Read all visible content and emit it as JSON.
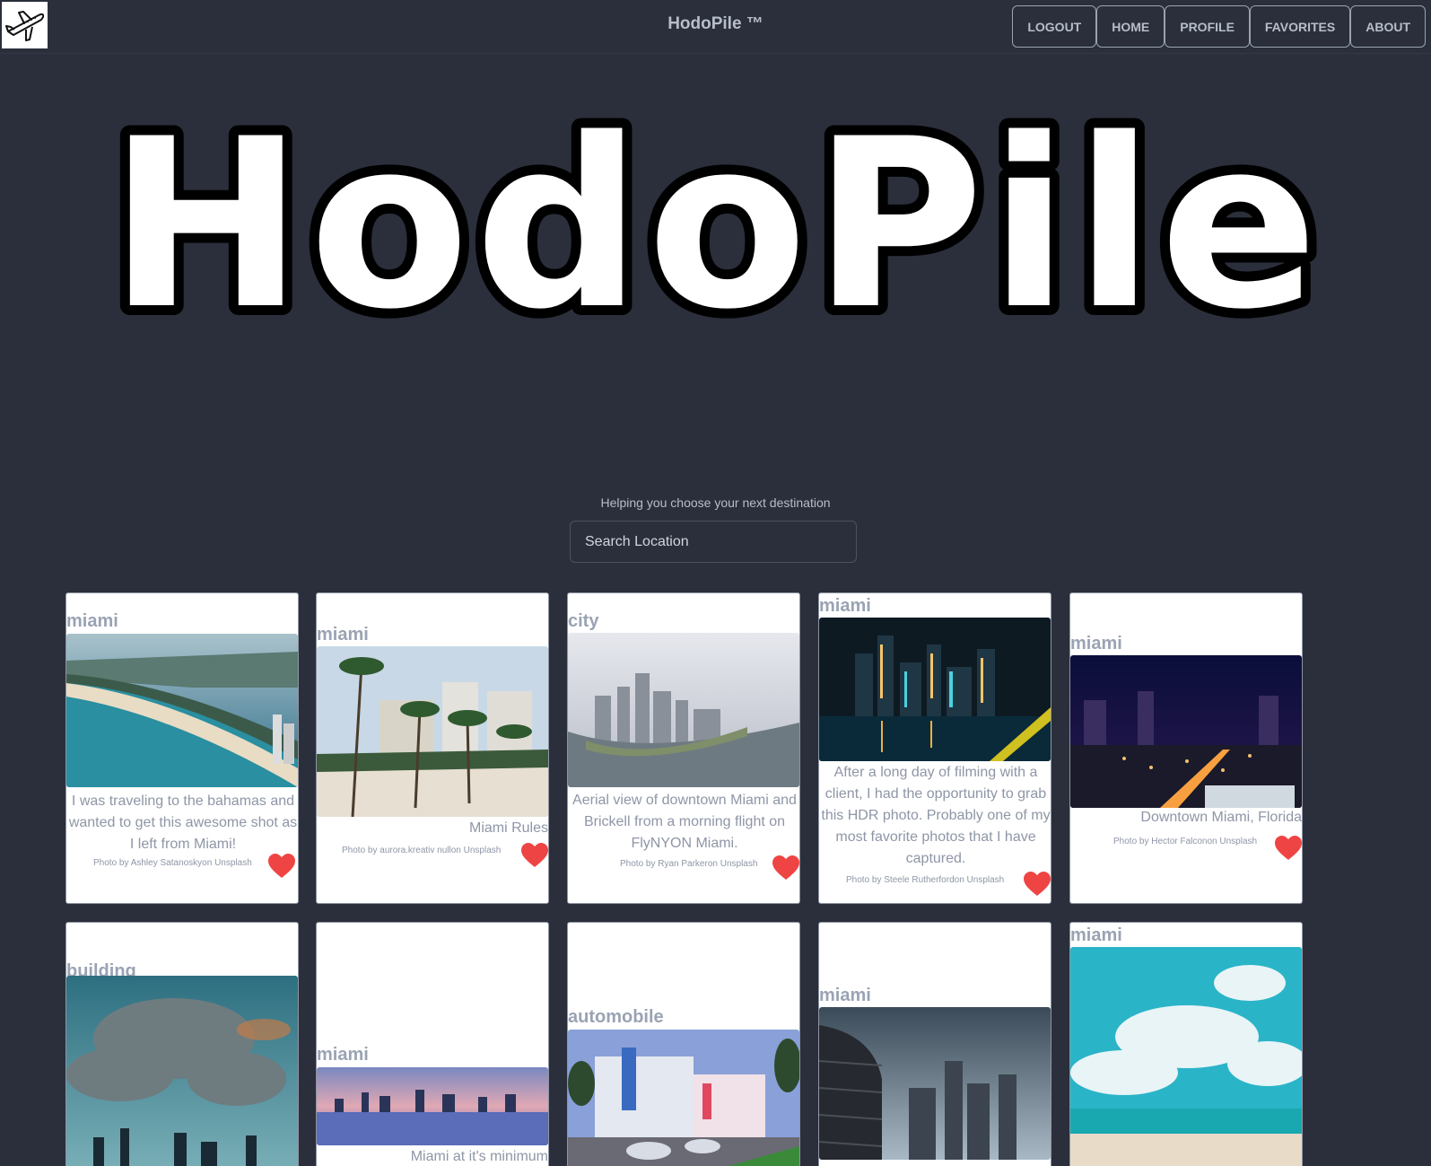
{
  "nav": {
    "brand": "HodoPile ™",
    "buttons": [
      "LOGOUT",
      "HOME",
      "PROFILE",
      "FAVORITES",
      "ABOUT"
    ]
  },
  "hero": {
    "title": "HodoPile"
  },
  "search": {
    "tagline": "Helping you choose your next destination",
    "placeholder": "Search Location"
  },
  "cards": [
    {
      "tag": "miami",
      "description": "I was traveling to the bahamas and wanted to get this awesome shot as I left from Miami!",
      "credit": "Photo by Ashley Satanoskyon Unsplash"
    },
    {
      "tag": "miami",
      "description": "Miami Rules",
      "credit": "Photo by aurora.kreativ nullon Unsplash"
    },
    {
      "tag": "city",
      "description": "Aerial view of downtown Miami and Brickell from a morning flight on FlyNYON Miami.",
      "credit": "Photo by Ryan Parkeron Unsplash"
    },
    {
      "tag": "miami",
      "description": "After a long day of filming with a client, I had the opportunity to grab this HDR photo. Probably one of my most favorite photos that I have captured.",
      "credit": "Photo by Steele Rutherfordon Unsplash"
    },
    {
      "tag": "miami",
      "description": "Downtown Miami, Florida",
      "credit": "Photo by Hector Falconon Unsplash"
    },
    {
      "tag": "building",
      "description": "",
      "credit": ""
    },
    {
      "tag": "miami",
      "description": "Miami at it's minimum",
      "credit": ""
    },
    {
      "tag": "automobile",
      "description": "",
      "credit": ""
    },
    {
      "tag": "miami",
      "description": "",
      "credit": ""
    },
    {
      "tag": "miami",
      "description": "",
      "credit": ""
    }
  ],
  "colors": {
    "background": "#2a2f3b",
    "heart": "#ef4444",
    "tag": "#9aa3b3"
  }
}
